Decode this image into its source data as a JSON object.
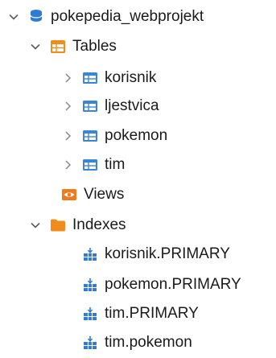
{
  "tree": {
    "database": {
      "label": "pokepedia_webprojekt",
      "icon": "database-icon",
      "expanded": true
    },
    "tables": {
      "label": "Tables",
      "icon": "table-folder-icon",
      "expanded": true,
      "items": [
        {
          "label": "korisnik",
          "icon": "table-icon"
        },
        {
          "label": "ljestvica",
          "icon": "table-icon"
        },
        {
          "label": "pokemon",
          "icon": "table-icon"
        },
        {
          "label": "tim",
          "icon": "table-icon"
        }
      ]
    },
    "views": {
      "label": "Views",
      "icon": "views-eye-icon"
    },
    "indexes": {
      "label": "Indexes",
      "icon": "folder-icon",
      "expanded": true,
      "items": [
        {
          "label": "korisnik.PRIMARY",
          "icon": "index-icon"
        },
        {
          "label": "pokemon.PRIMARY",
          "icon": "index-icon"
        },
        {
          "label": "tim.PRIMARY",
          "icon": "index-icon"
        },
        {
          "label": "tim.pokemon",
          "icon": "index-icon"
        }
      ]
    }
  },
  "colors": {
    "database": "#2f7bd3",
    "table_blue": "#3b86d4",
    "folder_orange": "#f08c1c",
    "views_orange": "#f07b1c",
    "index_blue": "#2f7bd3",
    "chevron": "#5b5b5b"
  }
}
